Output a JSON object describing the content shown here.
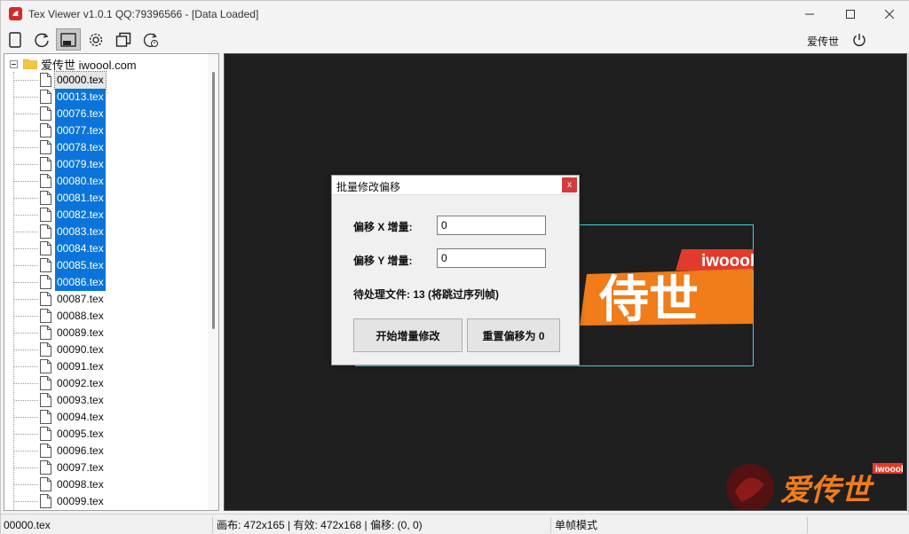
{
  "window": {
    "title": "Tex Viewer v1.0.1 QQ:79396566 - [Data Loaded]"
  },
  "toolbar": {
    "buttons": [
      {
        "icon": "new-file-icon"
      },
      {
        "icon": "refresh-icon"
      },
      {
        "icon": "frame-mode-icon",
        "active": true
      },
      {
        "icon": "gear-icon"
      },
      {
        "icon": "copy-icon"
      },
      {
        "icon": "reset-offset-icon"
      }
    ],
    "user_label": "爱传世",
    "power_icon": "power-icon"
  },
  "tree": {
    "root_label": "爱传世 iwoool.com",
    "items": [
      {
        "label": "00000.tex",
        "state": "focus"
      },
      {
        "label": "00013.tex",
        "state": "sel"
      },
      {
        "label": "00076.tex",
        "state": "sel"
      },
      {
        "label": "00077.tex",
        "state": "sel"
      },
      {
        "label": "00078.tex",
        "state": "sel"
      },
      {
        "label": "00079.tex",
        "state": "sel"
      },
      {
        "label": "00080.tex",
        "state": "sel"
      },
      {
        "label": "00081.tex",
        "state": "sel"
      },
      {
        "label": "00082.tex",
        "state": "sel"
      },
      {
        "label": "00083.tex",
        "state": "sel"
      },
      {
        "label": "00084.tex",
        "state": "sel"
      },
      {
        "label": "00085.tex",
        "state": "sel"
      },
      {
        "label": "00086.tex",
        "state": "sel"
      },
      {
        "label": "00087.tex",
        "state": ""
      },
      {
        "label": "00088.tex",
        "state": ""
      },
      {
        "label": "00089.tex",
        "state": ""
      },
      {
        "label": "00090.tex",
        "state": ""
      },
      {
        "label": "00091.tex",
        "state": ""
      },
      {
        "label": "00092.tex",
        "state": ""
      },
      {
        "label": "00093.tex",
        "state": ""
      },
      {
        "label": "00094.tex",
        "state": ""
      },
      {
        "label": "00095.tex",
        "state": ""
      },
      {
        "label": "00096.tex",
        "state": ""
      },
      {
        "label": "00097.tex",
        "state": ""
      },
      {
        "label": "00098.tex",
        "state": ""
      },
      {
        "label": "00099.tex",
        "state": ""
      }
    ]
  },
  "preview": {
    "logo_text": "iwoool",
    "logo_chars": "侍世",
    "watermark_chars": "爱传世",
    "watermark_tag": "iwoool"
  },
  "dialog": {
    "title": "批量修改偏移",
    "close_label": "x",
    "x_label": "偏移 X 增量:",
    "x_value": "0",
    "y_label": "偏移 Y 增量:",
    "y_value": "0",
    "info": "待处理文件: 13 (将跳过序列帧)",
    "apply_button": "开始增量修改",
    "reset_button": "重置偏移为 0"
  },
  "status": {
    "file": "00000.tex",
    "dims": "画布: 472x165 | 有效: 472x168 | 偏移: (0, 0)",
    "mode": "单帧模式"
  },
  "colors": {
    "selection": "#0a74da",
    "canvas_border": "#3fd0e0",
    "logo_orange": "#f07c1a",
    "logo_red": "#e23b2b",
    "dialog_close": "#d43a3a"
  }
}
